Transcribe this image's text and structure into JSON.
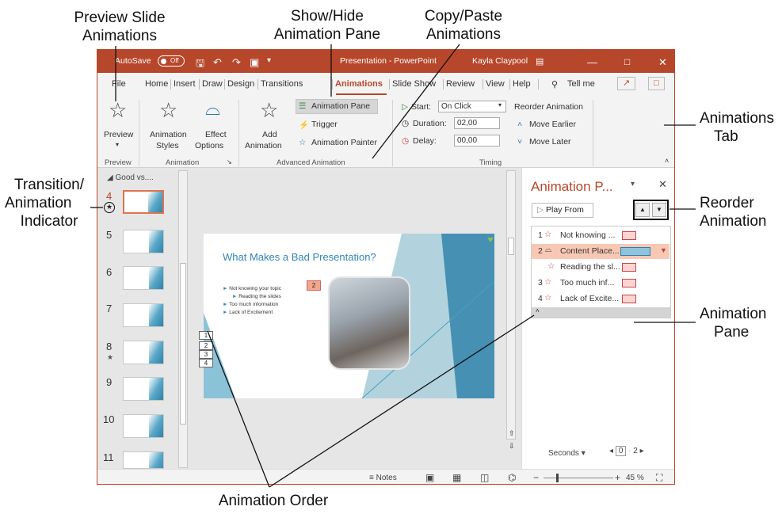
{
  "callouts": {
    "preview": [
      "Preview Slide",
      "Animations"
    ],
    "showhide": [
      "Show/Hide",
      "Animation Pane"
    ],
    "copypaste": [
      "Copy/Paste",
      "Animations"
    ],
    "animtab": [
      "Animations",
      "Tab"
    ],
    "transition": [
      "Transition/",
      "Animation",
      "Indicator"
    ],
    "reorder": [
      "Reorder",
      "Animation"
    ],
    "animpane": [
      "Animation",
      "Pane"
    ],
    "animorder": "Animation Order"
  },
  "titlebar": {
    "autosave": "AutoSave",
    "toggle": "Off",
    "title": "Presentation - PowerPoint",
    "user": "Kayla Claypool"
  },
  "tabs": [
    "File",
    "Home",
    "Insert",
    "Draw",
    "Design",
    "Transitions",
    "Animations",
    "Slide Show",
    "Review",
    "View",
    "Help"
  ],
  "tellme": "Tell me",
  "ribbon": {
    "preview": "Preview",
    "anim_styles": [
      "Animation",
      "Styles"
    ],
    "effect_options": [
      "Effect",
      "Options"
    ],
    "add_animation": [
      "Add",
      "Animation"
    ],
    "animation_pane": "Animation Pane",
    "trigger": "Trigger",
    "animation_painter": "Animation Painter",
    "start_label": "Start:",
    "start_value": "On Click",
    "duration_label": "Duration:",
    "duration_value": "02,00",
    "delay_label": "Delay:",
    "delay_value": "00,00",
    "reorder_title": "Reorder Animation",
    "move_earlier": "Move Earlier",
    "move_later": "Move Later",
    "groups": [
      "Preview",
      "Animation",
      "Advanced Animation",
      "Timing"
    ]
  },
  "thumbs": {
    "section": "Good vs....",
    "slides": [
      "4",
      "5",
      "6",
      "7",
      "8",
      "9",
      "10",
      "11"
    ]
  },
  "slide": {
    "title": "What Makes a Bad Presentation?",
    "bullets": [
      "Not knowing your topic",
      "Reading the slides",
      "Too much information",
      "Lack of Excitement"
    ],
    "nums": [
      "1",
      "2",
      "3",
      "4"
    ],
    "badge": "2"
  },
  "pane": {
    "title": "Animation P...",
    "play_from": "Play From",
    "items": [
      {
        "num": "1",
        "label": "Not knowing ..."
      },
      {
        "num": "2",
        "label": "Content Place..."
      },
      {
        "num": "",
        "label": "Reading the sl..."
      },
      {
        "num": "3",
        "label": "Too much inf..."
      },
      {
        "num": "4",
        "label": "Lack of Excite..."
      }
    ],
    "seconds": "Seconds",
    "timeline": [
      "0",
      "2"
    ]
  },
  "status": {
    "notes": "Notes",
    "zoom": "45 %"
  },
  "colors": {
    "accent": "#b7472a",
    "title_blue": "#2e86b8",
    "selected_item": "#f8c8b4"
  }
}
